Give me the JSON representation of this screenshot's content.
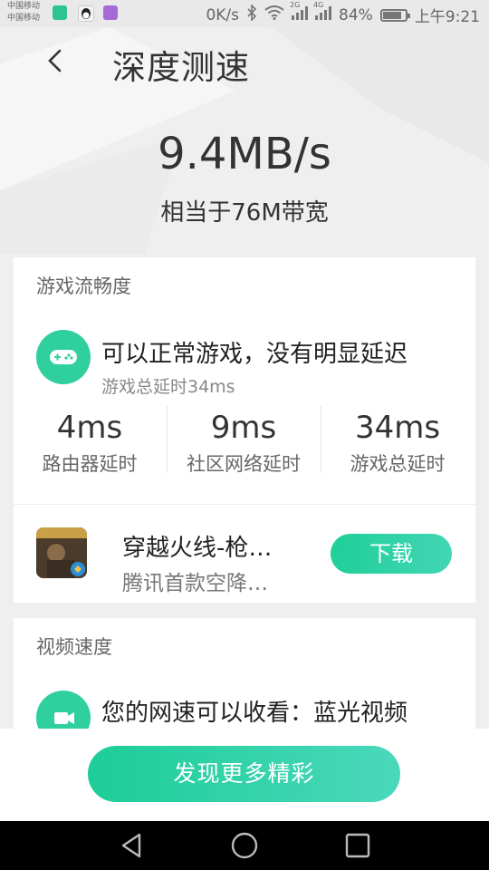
{
  "status_bar": {
    "carrier_1": "中国移动",
    "carrier_2": "中国移动",
    "net_speed": "0K/s",
    "net_2g": "2G",
    "net_4g": "4G",
    "battery_percent": "84%",
    "battery_level": 0.84,
    "time": "上午9:21"
  },
  "header": {
    "title": "深度测速",
    "back_icon": "chevron-left-icon"
  },
  "result": {
    "speed": "9.4MB/s",
    "bandwidth": "相当于76M带宽"
  },
  "game_section": {
    "title": "游戏流畅度",
    "icon": "gamepad-icon",
    "summary": "可以正常游戏，没有明显延迟",
    "total_latency": "游戏总延时34ms",
    "stats": [
      {
        "value": "4ms",
        "label": "路由器延时"
      },
      {
        "value": "9ms",
        "label": "社区网络延时"
      },
      {
        "value": "34ms",
        "label": "游戏总延时"
      }
    ],
    "app": {
      "name": "穿越火线-枪…",
      "desc": "腾讯首款空降…",
      "download_label": "下载"
    }
  },
  "video_section": {
    "title": "视频速度",
    "icon": "video-camera-icon",
    "summary": "您的网速可以收看：蓝光视频"
  },
  "footer": {
    "discover_label": "发现更多精彩"
  },
  "colors": {
    "accent": "#2fcf9e",
    "background": "#efefef"
  }
}
